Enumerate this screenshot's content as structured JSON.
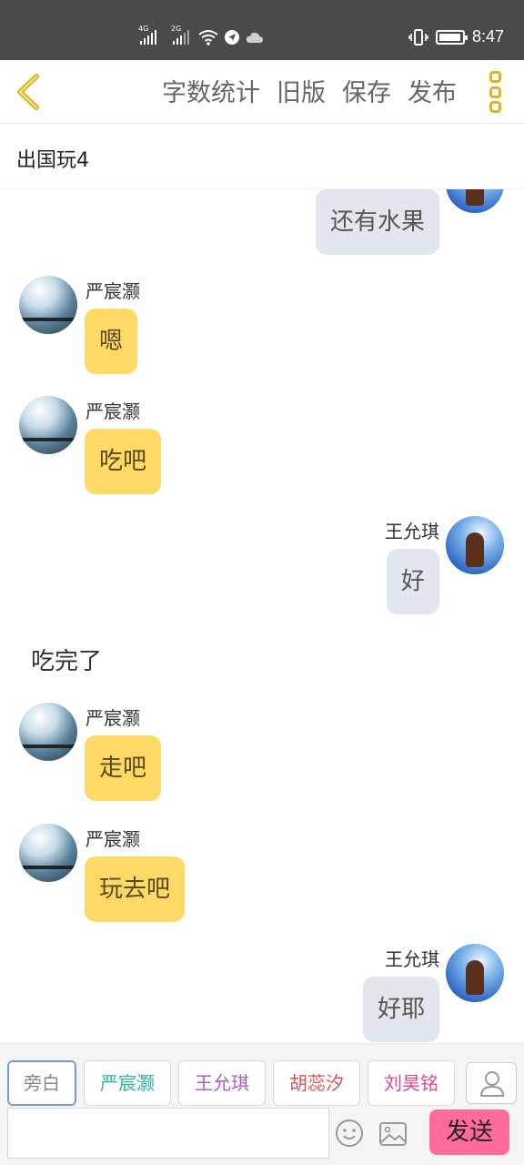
{
  "status_bar": {
    "time": "8:47",
    "sim1_label": "4G",
    "sim2_label": "2G"
  },
  "toolbar": {
    "items": [
      "字数统计",
      "旧版",
      "保存",
      "发布"
    ],
    "accent_color": "#d8b828"
  },
  "document": {
    "title": "出国玩4"
  },
  "messages": [
    {
      "type": "right",
      "name": "",
      "text": "还有水果"
    },
    {
      "type": "left",
      "name": "严宸灏",
      "text": "嗯"
    },
    {
      "type": "left",
      "name": "严宸灏",
      "text": "吃吧"
    },
    {
      "type": "right",
      "name": "王允琪",
      "text": "好"
    },
    {
      "type": "narration",
      "text": "吃完了"
    },
    {
      "type": "left",
      "name": "严宸灏",
      "text": "走吧"
    },
    {
      "type": "left",
      "name": "严宸灏",
      "text": "玩去吧"
    },
    {
      "type": "right",
      "name": "王允琪",
      "text": "好耶"
    }
  ],
  "roles": [
    {
      "label": "旁白",
      "color": "#888888",
      "selected": true
    },
    {
      "label": "严宸灏",
      "color": "#2fb5a6",
      "selected": false
    },
    {
      "label": "王允琪",
      "color": "#b05cc8",
      "selected": false
    },
    {
      "label": "胡蕊汐",
      "color": "#d9534f",
      "selected": false
    },
    {
      "label": "刘昊铭",
      "color": "#e0478e",
      "selected": false
    }
  ],
  "composer": {
    "input_value": "",
    "send_label": "发送"
  },
  "colors": {
    "left_bubble": "#ffd966",
    "right_bubble": "#e2e7ee",
    "send_button": "#ff6b9d"
  }
}
